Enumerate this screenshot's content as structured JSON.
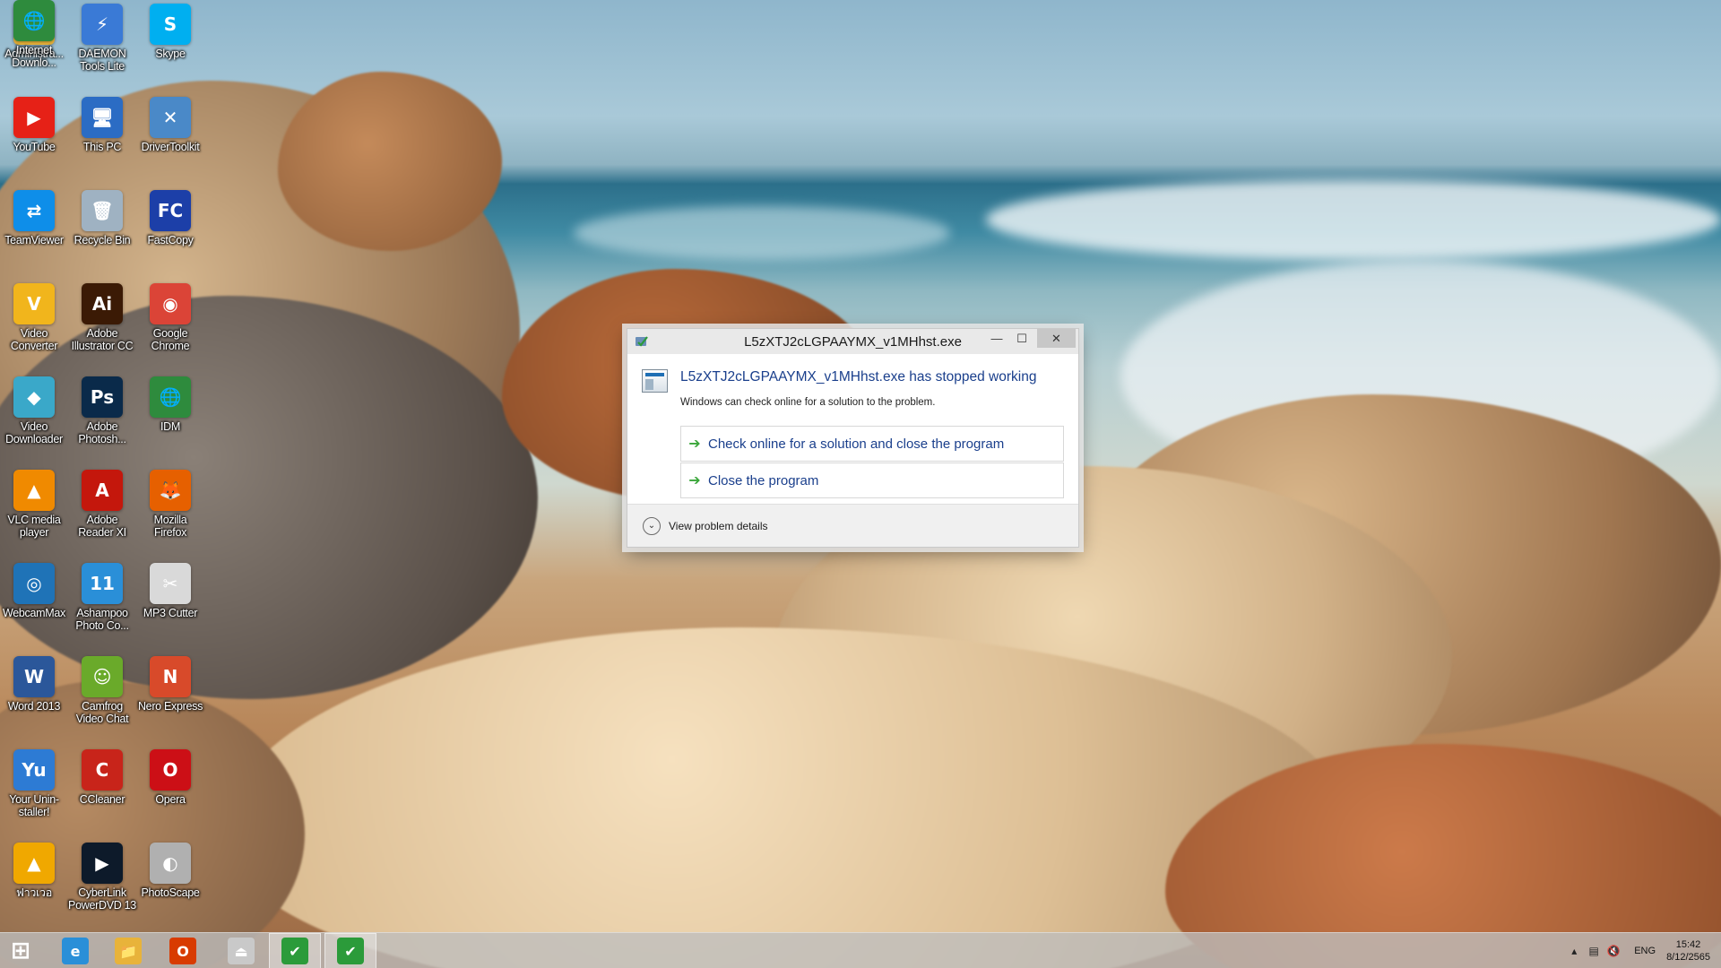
{
  "desktop": {
    "icons": [
      {
        "id": "administrator",
        "label": "Administra...",
        "icon": "folder-user-icon",
        "color": "#e8b33a",
        "glyph": "📁"
      },
      {
        "id": "daemon-tools",
        "label": "DAEMON Tools Lite",
        "icon": "lightning-disc-icon",
        "color": "#3a7ad6",
        "glyph": "⚡"
      },
      {
        "id": "skype",
        "label": "Skype",
        "icon": "skype-icon",
        "color": "#00aff0",
        "glyph": "S"
      },
      {
        "id": "youtube",
        "label": "YouTube",
        "icon": "youtube-icon",
        "color": "#e62117",
        "glyph": "▶"
      },
      {
        "id": "this-pc",
        "label": "This PC",
        "icon": "monitor-icon",
        "color": "#2b6cc4",
        "glyph": "🖥"
      },
      {
        "id": "drivertoolkit",
        "label": "DriverToolkit",
        "icon": "tools-icon",
        "color": "#4a89c8",
        "glyph": "✕"
      },
      {
        "id": "teamviewer",
        "label": "TeamViewer",
        "icon": "teamviewer-icon",
        "color": "#0e8ee9",
        "glyph": "⇄"
      },
      {
        "id": "recycle-bin",
        "label": "Recycle Bin",
        "icon": "recycle-bin-icon",
        "color": "#9fb2c2",
        "glyph": "🗑"
      },
      {
        "id": "fastcopy",
        "label": "FastCopy",
        "icon": "fastcopy-icon",
        "color": "#1c3fa8",
        "glyph": "FC"
      },
      {
        "id": "video-converter",
        "label": "Video Converter",
        "icon": "v-logo-icon",
        "color": "#f1b51c",
        "glyph": "V"
      },
      {
        "id": "illustrator",
        "label": "Adobe Illustrator CC",
        "icon": "illustrator-icon",
        "color": "#3b1a05",
        "glyph": "Ai"
      },
      {
        "id": "chrome",
        "label": "Google Chrome",
        "icon": "chrome-icon",
        "color": "#db4437",
        "glyph": "◉"
      },
      {
        "id": "video-downloader",
        "label": "Video Downloader",
        "icon": "download-diamond-icon",
        "color": "#3aa8c9",
        "glyph": "◆"
      },
      {
        "id": "photoshop",
        "label": "Adobe Photosh...",
        "icon": "photoshop-icon",
        "color": "#0a2a4a",
        "glyph": "Ps"
      },
      {
        "id": "idm",
        "label": "IDM",
        "icon": "idm-globe-icon",
        "color": "#2e8b3d",
        "glyph": "🌐"
      },
      {
        "id": "vlc",
        "label": "VLC media player",
        "icon": "vlc-cone-icon",
        "color": "#f08a00",
        "glyph": "▲"
      },
      {
        "id": "acrobat",
        "label": "Adobe Reader XI",
        "icon": "acrobat-icon",
        "color": "#c4170c",
        "glyph": "A"
      },
      {
        "id": "firefox",
        "label": "Mozilla Firefox",
        "icon": "firefox-icon",
        "color": "#e66000",
        "glyph": "🦊"
      },
      {
        "id": "webcammax",
        "label": "WebcamMax",
        "icon": "webcam-icon",
        "color": "#1f73b7",
        "glyph": "◎"
      },
      {
        "id": "ashampoo",
        "label": "Ashampoo Photo Co...",
        "icon": "ashampoo-icon",
        "color": "#2a8fd8",
        "glyph": "11"
      },
      {
        "id": "mp3-cutter",
        "label": "MP3 Cutter",
        "icon": "scissors-icon",
        "color": "#d9d9d9",
        "glyph": "✂"
      },
      {
        "id": "word",
        "label": "Word 2013",
        "icon": "word-icon",
        "color": "#2b579a",
        "glyph": "W"
      },
      {
        "id": "camfrog",
        "label": "Camfrog Video Chat",
        "icon": "camfrog-icon",
        "color": "#6aaa2a",
        "glyph": "☺"
      },
      {
        "id": "nero",
        "label": "Nero Express",
        "icon": "nero-icon",
        "color": "#d84a2a",
        "glyph": "N"
      },
      {
        "id": "uninstaller",
        "label": "Your Unin-staller!",
        "icon": "uninstaller-icon",
        "color": "#2d7bd4",
        "glyph": "Yu"
      },
      {
        "id": "ccleaner",
        "label": "CCleaner",
        "icon": "ccleaner-icon",
        "color": "#c8241a",
        "glyph": "C"
      },
      {
        "id": "opera",
        "label": "Opera",
        "icon": "opera-icon",
        "color": "#cc0f16",
        "glyph": "O"
      },
      {
        "id": "unknown-app",
        "label": "ฟาวเวอ",
        "icon": "triangle-logo-icon",
        "color": "#f0a800",
        "glyph": "▲"
      },
      {
        "id": "powerdvd",
        "label": "CyberLink PowerDVD 13",
        "icon": "powerdvd-icon",
        "color": "#0d1a2a",
        "glyph": "▶"
      },
      {
        "id": "photoscape",
        "label": "PhotoScape",
        "icon": "photoscape-icon",
        "color": "#b0b0b0",
        "glyph": "◐"
      },
      {
        "id": "internet-download",
        "label": "Internet Downlo...",
        "icon": "idm-globe-icon",
        "color": "#2e8b3d",
        "glyph": "🌐"
      }
    ]
  },
  "dialog": {
    "title": "L5zXTJ2cLGPAAYMX_v1MHhst.exe",
    "heading": "L5zXTJ2cLGPAAYMX_v1MHhst.exe has stopped working",
    "message": "Windows can check online for a solution to the problem.",
    "option_check": "Check online for a solution and close the program",
    "option_close": "Close the program",
    "details_label": "View problem details",
    "minimize_glyph": "—",
    "maximize_glyph": "☐",
    "close_glyph": "✕"
  },
  "taskbar": {
    "items": [
      {
        "id": "start",
        "icon": "windows-start-icon",
        "glyph": "⊞",
        "color": "#ffffff",
        "active": false
      },
      {
        "id": "ie",
        "icon": "internet-explorer-icon",
        "glyph": "e",
        "color": "#2a8fd8",
        "active": false
      },
      {
        "id": "explorer",
        "icon": "file-explorer-icon",
        "glyph": "📁",
        "color": "#e8b33a",
        "active": false
      },
      {
        "id": "office",
        "icon": "office-icon",
        "glyph": "O",
        "color": "#d83b01",
        "active": false
      },
      {
        "id": "tray-app",
        "icon": "hardware-drive-icon",
        "glyph": "⏏",
        "color": "#c9c9c9",
        "active": false
      },
      {
        "id": "error-app-1",
        "icon": "checkmark-app-icon",
        "glyph": "✔",
        "color": "#2b9b3a",
        "active": true
      },
      {
        "id": "error-app-2",
        "icon": "checkmark-app-icon",
        "glyph": "✔",
        "color": "#2b9b3a",
        "active": true
      }
    ],
    "tray": {
      "language": "ENG",
      "time": "15:42",
      "date": "8/12/2565"
    }
  }
}
